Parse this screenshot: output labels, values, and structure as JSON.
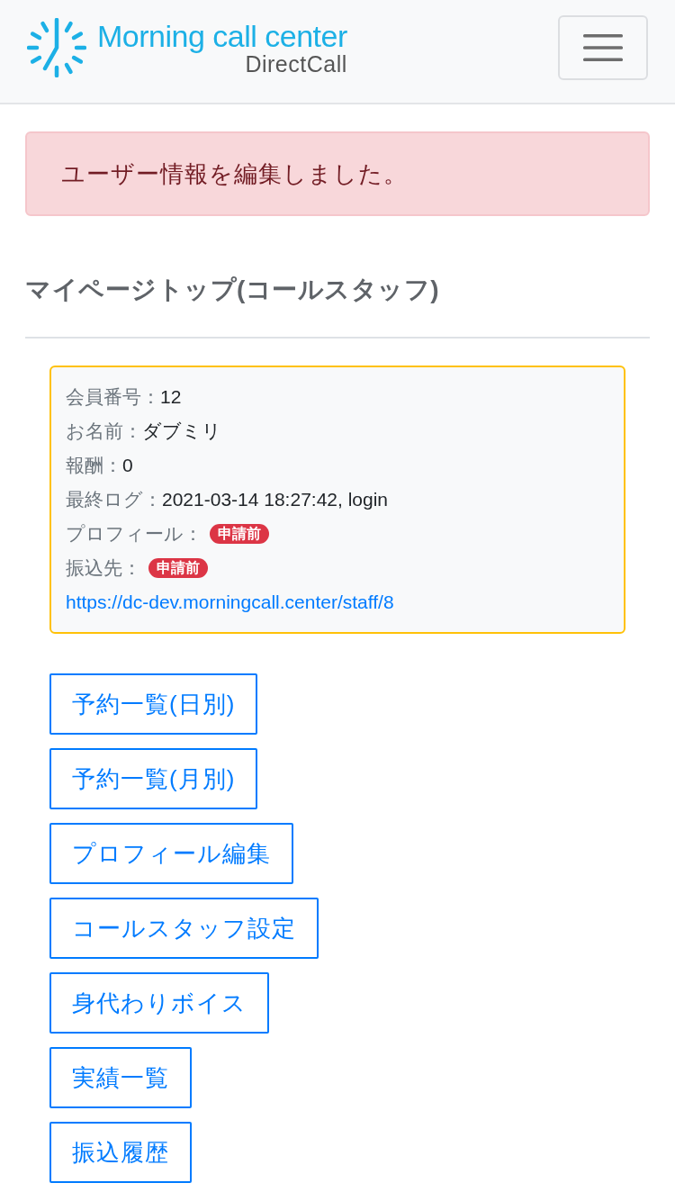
{
  "header": {
    "logo": {
      "title": "Morning call center",
      "subtitle": "DirectCall"
    }
  },
  "alert": {
    "message": "ユーザー情報を編集しました。"
  },
  "page_title": "マイページトップ(コールスタッフ)",
  "profile_card": {
    "fields": [
      {
        "kind": "text",
        "label": "会員番号：",
        "value": "12"
      },
      {
        "kind": "text",
        "label": "お名前：",
        "value": "ダブミリ"
      },
      {
        "kind": "text",
        "label": "報酬：",
        "value": "0"
      },
      {
        "kind": "text",
        "label": "最終ログ：",
        "value": "2021-03-14 18:27:42, login"
      },
      {
        "kind": "badge",
        "label": "プロフィール：",
        "value": "申請前"
      },
      {
        "kind": "badge",
        "label": "振込先：",
        "value": "申請前"
      }
    ],
    "link": "https://dc-dev.morningcall.center/staff/8"
  },
  "menu_buttons": [
    "予約一覧(日別)",
    "予約一覧(月別)",
    "プロフィール編集",
    "コールスタッフ設定",
    "身代わりボイス",
    "実績一覧",
    "振込履歴"
  ]
}
